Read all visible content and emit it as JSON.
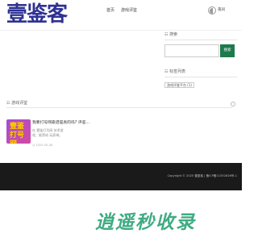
{
  "header": {
    "logo_text": "壹鉴客",
    "nav": [
      "首页",
      "游戏评鉴"
    ],
    "mode_label": "夜间"
  },
  "sidebar": {
    "search_title": "搜索",
    "search_placeholder": "",
    "search_button": "搜索",
    "tags_title": "标签列表",
    "tags": [
      "游戏评鉴平台 (1)"
    ]
  },
  "main": {
    "section_title": "游戏评鉴",
    "posts": [
      {
        "thumb_text": "壹鉴打号网",
        "title": "我要打号网靠谱是真的吗? 评鉴…",
        "excerpt": "在 壹鉴打号网 技术游戏、推荐给 玩家带。",
        "date": "2025-05-08"
      }
    ]
  },
  "footer": {
    "copyright": "Copyright © 2025 壹鉴客 | 备ICP备11552626号-1"
  },
  "watermark": "逍遥秒收录",
  "colors": {
    "logo": "#2e3192",
    "search_button": "#1d7a4b",
    "footer_bg": "#1a1a1a",
    "watermark": "#1e9d6e"
  }
}
